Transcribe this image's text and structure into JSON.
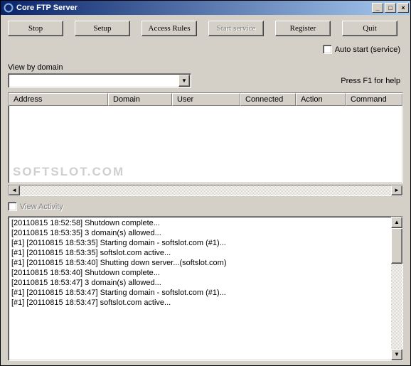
{
  "titlebar": {
    "title": "Core FTP Server",
    "min_glyph": "_",
    "max_glyph": "□",
    "close_glyph": "×"
  },
  "toolbar": {
    "stop": "Stop",
    "setup": "Setup",
    "access_rules": "Access Rules",
    "start_service": "Start service",
    "register": "Register",
    "quit": "Quit"
  },
  "options": {
    "auto_start": "Auto start (service)",
    "view_by_domain": "View by domain",
    "help_text": "Press F1 for help",
    "view_activity": "View Activity",
    "dropdown_value": "",
    "combo_arrow": "▼"
  },
  "grid": {
    "columns": [
      "Address",
      "Domain",
      "User",
      "Connected",
      "Action",
      "Command"
    ],
    "rows": []
  },
  "watermark": "SOFTSLOT.COM",
  "scroll": {
    "left": "◄",
    "right": "►",
    "up": "▲",
    "down": "▼"
  },
  "log": [
    "[20110815 18:52:58] Shutdown complete...",
    "[20110815 18:53:35] 3 domain(s) allowed...",
    "[#1] [20110815 18:53:35] Starting domain - softslot.com (#1)...",
    "[#1] [20110815 18:53:35] softslot.com active...",
    "[#1] [20110815 18:53:40] Shutting down server...(softslot.com)",
    "[20110815 18:53:40] Shutdown complete...",
    "[20110815 18:53:47] 3 domain(s) allowed...",
    "[#1] [20110815 18:53:47] Starting domain - softslot.com (#1)...",
    "[#1] [20110815 18:53:47] softslot.com active..."
  ]
}
